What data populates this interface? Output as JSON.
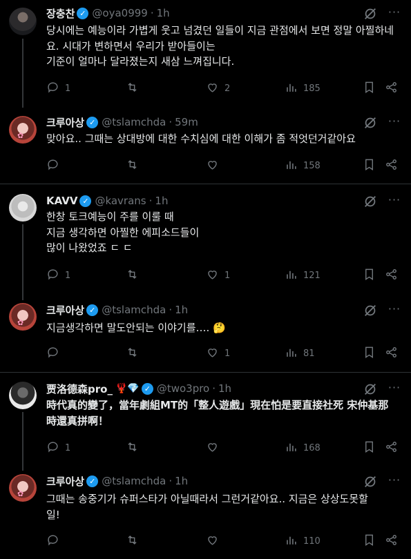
{
  "tweets": [
    {
      "name": "장충찬",
      "verified": true,
      "emoji": "",
      "handle": "@oya0999",
      "time": "1h",
      "text": "당시에는 예능이라 가볍게 웃고 넘겼던 일들이 지금 관점에서 보면 정말 아찔하네요. 시대가 변하면서 우리가 받아들이는\n기준이 얼마나 달라졌는지 새삼 느껴집니다.",
      "replies": "1",
      "retweets": "",
      "likes": "2",
      "views": "185"
    },
    {
      "name": "크루아상",
      "verified": true,
      "emoji": "",
      "handle": "@tslamchda",
      "time": "59m",
      "text": "맞아요.. 그때는 상대방에 대한 수치심에 대한 이해가 좀 적엇던거같아요",
      "replies": "",
      "retweets": "",
      "likes": "",
      "views": "158"
    },
    {
      "name": "KAVV",
      "verified": true,
      "emoji": "",
      "handle": "@kavrans",
      "time": "1h",
      "text": "한창 토크예능이 주를 이룰 때\n지금 생각하면 아찔한 에피소드들이\n많이 나왔었죠 ㄷ ㄷ",
      "replies": "1",
      "retweets": "",
      "likes": "1",
      "views": "121"
    },
    {
      "name": "크루아상",
      "verified": true,
      "emoji": "",
      "handle": "@tslamchda",
      "time": "1h",
      "text": "지금생각하면 말도안되는 이야기를…. 🤔",
      "replies": "",
      "retweets": "",
      "likes": "1",
      "views": "81"
    },
    {
      "name": "贾洛德森pro_",
      "verified": true,
      "emoji": "🦞💎",
      "handle": "@two3pro",
      "time": "1h",
      "text": "時代真的變了，當年劇組MT的「整人遊戲」現在怕是要直接社死 宋仲基那\n時還真拼啊！",
      "replies": "1",
      "retweets": "",
      "likes": "",
      "views": "168"
    },
    {
      "name": "크루아상",
      "verified": true,
      "emoji": "",
      "handle": "@tslamchda",
      "time": "1h",
      "text": "그때는 송중기가 슈퍼스타가 아닐때라서 그런거같아요.. 지금은 상상도못할\n일!",
      "replies": "",
      "retweets": "",
      "likes": "",
      "views": "110"
    }
  ],
  "ui": {
    "separator": "·",
    "more": "···",
    "verified_mark": "✓"
  },
  "icons": {
    "reply": "reply-icon",
    "retweet": "retweet-icon",
    "like": "heart-icon",
    "views": "views-icon",
    "bookmark": "bookmark-icon",
    "share": "share-icon",
    "grok": "grok-icon"
  },
  "colors": {
    "background": "#000000",
    "text": "#e7e9ea",
    "muted": "#71767b",
    "verified": "#1d9bf0",
    "divider": "#2f3336"
  }
}
